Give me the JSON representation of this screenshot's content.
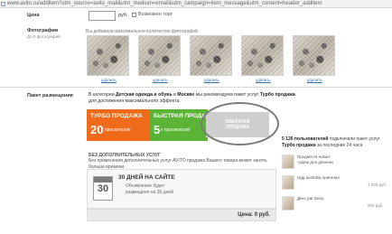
{
  "browser": {
    "url": "www.avito.ru/additem?utm_source=avito_mail&utm_medium=email&utm_campaign=item_message&utm_content=header_additem"
  },
  "form": {
    "price": {
      "label": "Цена",
      "value": "",
      "unit": "руб.",
      "negotiable_label": "Возможен торг",
      "negotiable_checked": false
    },
    "photos": {
      "label": "Фотографии",
      "sublabel": "До 5 фотографий",
      "hint": "Вы добавили максимальное количество фотографий",
      "items": [
        {
          "remove_label": "удалить"
        },
        {
          "remove_label": "удалить"
        },
        {
          "remove_label": "удалить"
        },
        {
          "remove_label": "удалить"
        },
        {
          "remove_label": "удалить"
        }
      ]
    }
  },
  "packages": {
    "label": "Пакет размещения",
    "intro_part1": "В категории ",
    "intro_bold1": "Детская одежда и обувь",
    "intro_part2": " в ",
    "intro_bold2": "Москве",
    "intro_part3": " мы рекомендуем пакет услуг ",
    "intro_bold3": "Турбо продажа",
    "intro_part4": " для достижения максимального эффекта.",
    "turbo": {
      "title": "ТУРБО ПРОДАЖА",
      "count": "20",
      "sub": "x просмотров!",
      "color": "#ef6a19"
    },
    "fast": {
      "title": "БЫСТРАЯ ПРОДАЖА",
      "count": "5",
      "sub": "x просмотров!",
      "color": "#5cb436"
    },
    "normal": {
      "title_line1": "ОБЫЧНАЯ",
      "title_line2": "ПРОДАЖА",
      "selected": true
    }
  },
  "extras": {
    "title": "Без дополнительных услуг",
    "text": "Без применения дополнительных услуг AVITO продажа Вашего товара может занять больше времени."
  },
  "service": {
    "calendar_number": "30",
    "title": "30 ДНЕЙ НА САЙТЕ",
    "text": "Объявление будет размещено на 30 дней"
  },
  "total": {
    "text": "Цена: 0 руб."
  },
  "sidebar": {
    "users_count": "5 126 пользователей",
    "users_text1": " подключили пакет услуг ",
    "users_bold": "Турбо продажа",
    "users_text2": " за последние 24 часа",
    "ads": [
      {
        "text": "Продается новая туфли для девочки",
        "price": ""
      },
      {
        "text": "Ugg australia оригинал",
        "price": "1 200 руб."
      },
      {
        "text": "Декс par Deux,",
        "price": "900 руб."
      }
    ]
  }
}
